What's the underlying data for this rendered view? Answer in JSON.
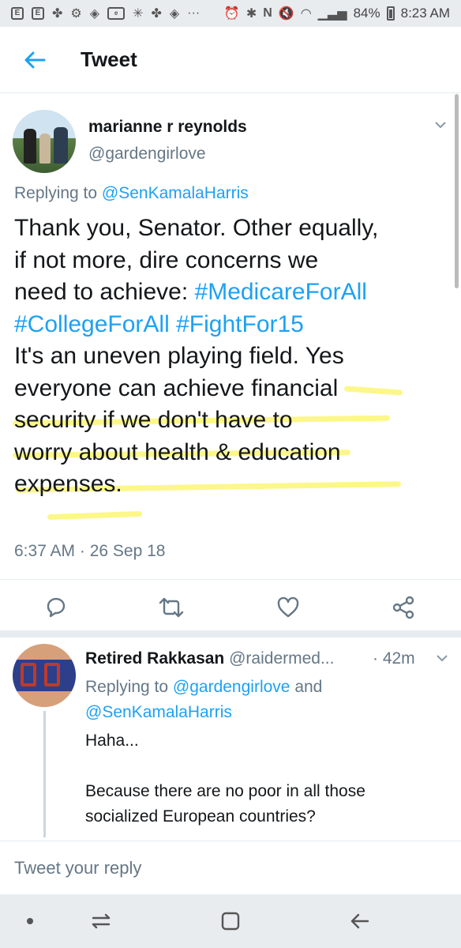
{
  "status_bar": {
    "battery": "84%",
    "time": "8:23 AM",
    "icons_left": [
      "notification-e-icon",
      "notification-e-icon",
      "accessibility-icon",
      "settings-icon",
      "tag-icon",
      "ebay-icon",
      "walmart-icon",
      "accessibility-icon",
      "tag-icon",
      "more-dots-icon"
    ],
    "icons_right": [
      "alarm-icon",
      "bluetooth-icon",
      "nfc-icon",
      "mute-icon",
      "wifi-icon",
      "signal-icon",
      "battery-icon"
    ]
  },
  "app_bar": {
    "title": "Tweet"
  },
  "main_tweet": {
    "display_name": "marianne r reynolds",
    "handle": "@gardengirlove",
    "replying_prefix": "Replying to",
    "replying_mention": "@SenKamalaHarris",
    "body_line1": "Thank you, Senator.  Other equally,",
    "body_line2": "if not more, dire concerns we",
    "body_line3": "need to achieve: ",
    "hashtag1": "#MedicareForAll",
    "hashtag2": "#CollegeForAll",
    "hashtag3": "#FightFor15",
    "body_line5": "It's an uneven playing field. Yes",
    "body_line6": "everyone can achieve financial",
    "body_line7": "security if we don't have to",
    "body_line8": "worry about health & education",
    "body_line9": "expenses.",
    "timestamp": "6:37 AM · 26 Sep 18",
    "highlight_color": "#faf028"
  },
  "reply_tweet": {
    "display_name": "Retired Rakkasan",
    "handle": "@raidermed...",
    "time": "· 42m",
    "replying_prefix": "Replying to",
    "mention1": "@gardengirlove",
    "and_word": "and",
    "mention2": "@SenKamalaHarris",
    "text_line1": "Haha...",
    "text_line2": "Because there are no poor in all those",
    "text_line3": "socialized European countries?"
  },
  "compose": {
    "placeholder": "Tweet your reply"
  },
  "colors": {
    "accent": "#1da1f2",
    "secondary_text": "#657786",
    "primary_text": "#14171a"
  }
}
